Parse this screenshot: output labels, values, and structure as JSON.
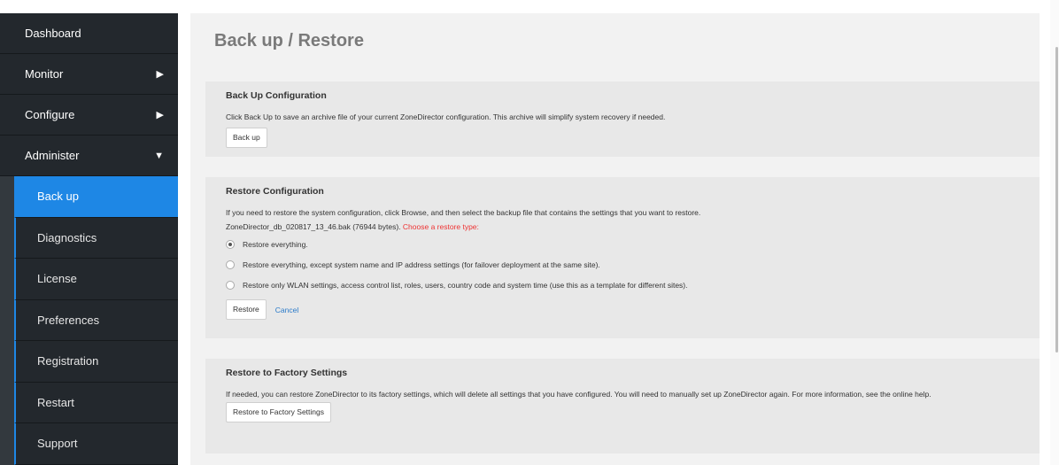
{
  "sidebar": {
    "top_items": [
      {
        "label": "Dashboard",
        "arrow": ""
      },
      {
        "label": "Monitor",
        "arrow": "▶"
      },
      {
        "label": "Configure",
        "arrow": "▶"
      },
      {
        "label": "Administer",
        "arrow": "▼"
      }
    ],
    "sub_items": [
      {
        "label": "Back up",
        "active": true
      },
      {
        "label": "Diagnostics"
      },
      {
        "label": "License"
      },
      {
        "label": "Preferences"
      },
      {
        "label": "Registration"
      },
      {
        "label": "Restart"
      },
      {
        "label": "Support"
      }
    ]
  },
  "page": {
    "title": "Back up / Restore"
  },
  "backup": {
    "title": "Back Up Configuration",
    "description": "Click Back Up to save an archive file of your current ZoneDirector configuration. This archive will simplify system recovery if needed.",
    "button": "Back up"
  },
  "restore": {
    "title": "Restore Configuration",
    "description": "If you need to restore the system configuration, click Browse, and then select the backup file that contains the settings that you want to restore.",
    "file_info": "ZoneDirector_db_020817_13_46.bak (76944 bytes).",
    "choose_label": "Choose a restore type:",
    "options": [
      "Restore everything.",
      "Restore everything, except system name and IP address settings (for failover deployment at the same site).",
      "Restore only WLAN settings, access control list, roles, users, country code and system time (use this as a template for different sites)."
    ],
    "selected_option": 0,
    "button": "Restore",
    "cancel": "Cancel"
  },
  "factory": {
    "title": "Restore to Factory Settings",
    "description": "If needed, you can restore ZoneDirector to its factory settings, which will delete all settings that you have configured. You will need to manually set up ZoneDirector again. For more information, see the online help.",
    "button": "Restore to Factory Settings"
  },
  "colors": {
    "accent": "#1e87e5",
    "sidebar_bg": "#23282d",
    "warning": "#ee3333",
    "link": "#2a7ac9"
  }
}
